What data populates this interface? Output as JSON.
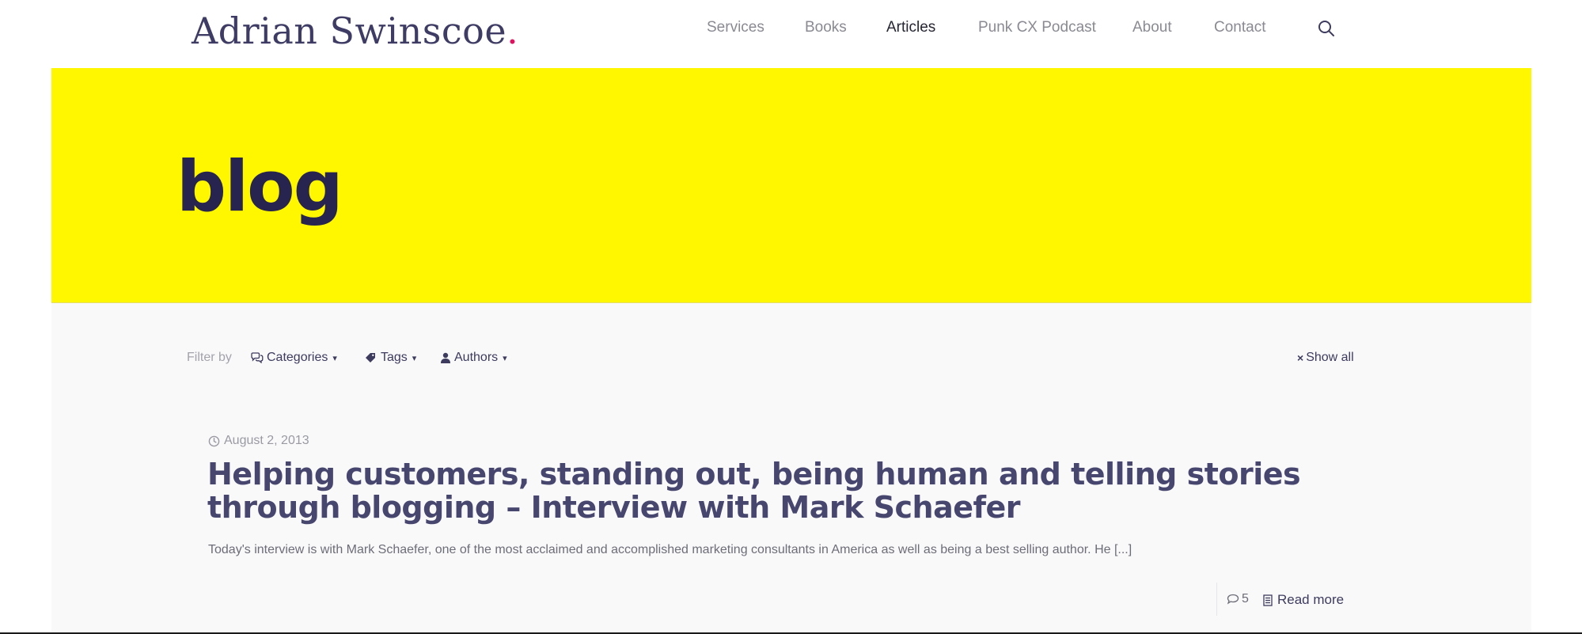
{
  "header": {
    "logo_text": "Adrian Swinscoe",
    "logo_dot": ".",
    "nav": [
      {
        "label": "Services",
        "active": false
      },
      {
        "label": "Books",
        "active": false
      },
      {
        "label": "Articles",
        "active": true
      },
      {
        "label": "Punk CX Podcast",
        "active": false
      },
      {
        "label": "About",
        "active": false
      },
      {
        "label": "Contact",
        "active": false
      }
    ],
    "search_icon": "search-icon"
  },
  "hero": {
    "title": "blog",
    "background": "#fff700"
  },
  "filters": {
    "label": "Filter by",
    "categories": "Categories",
    "tags": "Tags",
    "authors": "Authors",
    "caret": "▾",
    "show_all": "Show all",
    "show_all_icon": "×"
  },
  "post": {
    "date": "August 2, 2013",
    "title": "Helping customers, standing out, being human and telling stories through blogging – Interview with Mark Schaefer",
    "excerpt": "Today's interview is with Mark Schaefer, one of the most acclaimed and accomplished marketing consultants in America as well as being a best selling author. He [...]",
    "comment_count": "5",
    "read_more": "Read more"
  },
  "colors": {
    "brand_navy": "#3e3c64",
    "brand_accent": "#e0115f",
    "hero_yellow": "#fff700"
  }
}
